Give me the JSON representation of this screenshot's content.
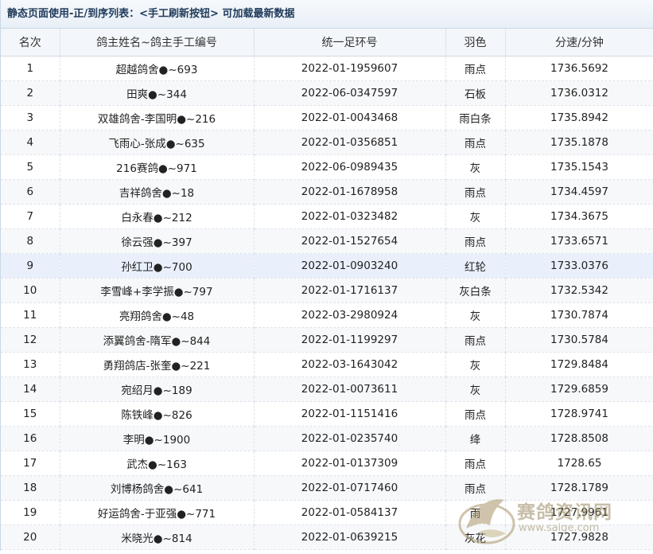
{
  "title": "静态页面使用-正/到序列表：<手工刷新按钮> 可加载最新数据",
  "columns": [
    "名次",
    "鸽主姓名~鸽主手工编号",
    "统一足环号",
    "羽色",
    "分速/分钟"
  ],
  "rows": [
    {
      "rank": "1",
      "name": "超越鸽舍●~693",
      "ring": "2022-01-1959607",
      "color": "雨点",
      "speed": "1736.5692"
    },
    {
      "rank": "2",
      "name": "田爽●~344",
      "ring": "2022-06-0347597",
      "color": "石板",
      "speed": "1736.0312"
    },
    {
      "rank": "3",
      "name": "双雄鸽舍-李国明●~216",
      "ring": "2022-01-0043468",
      "color": "雨白条",
      "speed": "1735.8942"
    },
    {
      "rank": "4",
      "name": "飞雨心-张成●~635",
      "ring": "2022-01-0356851",
      "color": "雨点",
      "speed": "1735.1878"
    },
    {
      "rank": "5",
      "name": "216赛鸽●~971",
      "ring": "2022-06-0989435",
      "color": "灰",
      "speed": "1735.1543"
    },
    {
      "rank": "6",
      "name": "吉祥鸽舍●~18",
      "ring": "2022-01-1678958",
      "color": "雨点",
      "speed": "1734.4597"
    },
    {
      "rank": "7",
      "name": "白永春●~212",
      "ring": "2022-01-0323482",
      "color": "灰",
      "speed": "1734.3675"
    },
    {
      "rank": "8",
      "name": "徐云强●~397",
      "ring": "2022-01-1527654",
      "color": "雨点",
      "speed": "1733.6571"
    },
    {
      "rank": "9",
      "name": "孙红卫●~700",
      "ring": "2022-01-0903240",
      "color": "红轮",
      "speed": "1733.0376"
    },
    {
      "rank": "10",
      "name": "李雪峰+李学振●~797",
      "ring": "2022-01-1716137",
      "color": "灰白条",
      "speed": "1732.5342"
    },
    {
      "rank": "11",
      "name": "亮翔鸽舍●~48",
      "ring": "2022-03-2980924",
      "color": "灰",
      "speed": "1730.7874"
    },
    {
      "rank": "12",
      "name": "添翼鸽舍-隋军●~844",
      "ring": "2022-01-1199297",
      "color": "雨点",
      "speed": "1730.5784"
    },
    {
      "rank": "13",
      "name": "勇翔鸽店-张奎●~221",
      "ring": "2022-03-1643042",
      "color": "灰",
      "speed": "1729.8484"
    },
    {
      "rank": "14",
      "name": "宛绍月●~189",
      "ring": "2022-01-0073611",
      "color": "灰",
      "speed": "1729.6859"
    },
    {
      "rank": "15",
      "name": "陈铁峰●~826",
      "ring": "2022-01-1151416",
      "color": "雨点",
      "speed": "1728.9741"
    },
    {
      "rank": "16",
      "name": "李明●~1900",
      "ring": "2022-01-0235740",
      "color": "绛",
      "speed": "1728.8508"
    },
    {
      "rank": "17",
      "name": "武杰●~163",
      "ring": "2022-01-0137309",
      "color": "雨点",
      "speed": "1728.65"
    },
    {
      "rank": "18",
      "name": "刘博杨鸽舍●~641",
      "ring": "2022-01-0717460",
      "color": "雨点",
      "speed": "1728.1789"
    },
    {
      "rank": "19",
      "name": "好运鸽舍-于亚强●~771",
      "ring": "2022-01-0584137",
      "color": "雨",
      "speed": "1727.9961"
    },
    {
      "rank": "20",
      "name": "米晓光●~814",
      "ring": "2022-01-0639215",
      "color": "灰花",
      "speed": "1727.9828"
    }
  ],
  "highlight_row_index": 8,
  "watermark": {
    "name": "赛鸽资讯网",
    "url": "www.saige.com",
    "icon": "pigeon-logo-icon"
  }
}
